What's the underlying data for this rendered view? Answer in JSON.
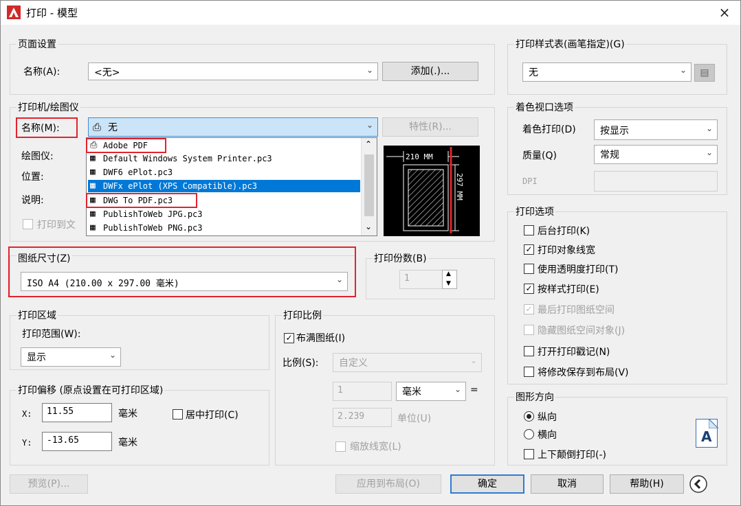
{
  "window": {
    "title": "打印 - 模型",
    "app_icon": "autocad-logo-icon",
    "close": "×"
  },
  "page_setup": {
    "group_label": "页面设置",
    "name_label": "名称(A):",
    "name_value": "<无>",
    "add_button": "添加(.)..."
  },
  "printer": {
    "group_label": "打印机/绘图仪",
    "name_label": "名称(M):",
    "name_value": "无",
    "properties_button": "特性(R)...",
    "plotter_label": "绘图仪:",
    "location_label": "位置:",
    "description_label": "说明:",
    "print_to_file_label": "打印到文",
    "dropdown_items": [
      "Adobe PDF",
      "Default Windows System Printer.pc3",
      "DWF6 ePlot.pc3",
      "DWFx ePlot (XPS Compatible).pc3",
      "DWG To PDF.pc3",
      "PublishToWeb JPG.pc3",
      "PublishToWeb PNG.pc3"
    ],
    "highlighted_index": 3,
    "preview_width": "210 MM",
    "preview_height": "297 MM"
  },
  "paper_size": {
    "group_label": "图纸尺寸(Z)",
    "value": "ISO A4 (210.00 x 297.00 毫米)"
  },
  "copies": {
    "group_label": "打印份数(B)",
    "value": "1"
  },
  "plot_area": {
    "group_label": "打印区域",
    "range_label": "打印范围(W):",
    "range_value": "显示"
  },
  "plot_scale": {
    "group_label": "打印比例",
    "fit_label": "布满图纸(I)",
    "fit_checked": true,
    "scale_label": "比例(S):",
    "scale_value": "自定义",
    "value1": "1",
    "unit1": "毫米",
    "equals": "=",
    "value2": "2.239",
    "unit2": "单位(U)",
    "scale_lineweights": "缩放线宽(L)"
  },
  "plot_offset": {
    "group_label": "打印偏移 (原点设置在可打印区域)",
    "x_label": "X:",
    "x_value": "11.55",
    "x_unit": "毫米",
    "y_label": "Y:",
    "y_value": "-13.65",
    "y_unit": "毫米",
    "center_label": "居中打印(C)"
  },
  "plot_style_table": {
    "group_label": "打印样式表(画笔指定)(G)",
    "value": "无"
  },
  "shaded_viewport": {
    "group_label": "着色视口选项",
    "shade_label": "着色打印(D)",
    "shade_value": "按显示",
    "quality_label": "质量(Q)",
    "quality_value": "常规",
    "dpi_label": "DPI"
  },
  "plot_options": {
    "group_label": "打印选项",
    "items": [
      {
        "label": "后台打印(K)",
        "checked": "",
        "disabled": false
      },
      {
        "label": "打印对象线宽",
        "checked": "✓",
        "disabled": false
      },
      {
        "label": "使用透明度打印(T)",
        "checked": "",
        "disabled": false
      },
      {
        "label": "按样式打印(E)",
        "checked": "✓",
        "disabled": false
      },
      {
        "label": "最后打印图纸空间",
        "checked": "✓",
        "disabled": true
      },
      {
        "label": "隐藏图纸空间对象(J)",
        "checked": "",
        "disabled": true
      },
      {
        "label": "打开打印戳记(N)",
        "checked": "",
        "disabled": false
      },
      {
        "label": "将修改保存到布局(V)",
        "checked": "",
        "disabled": false
      }
    ]
  },
  "orientation": {
    "group_label": "图形方向",
    "portrait": "纵向",
    "landscape": "横向",
    "upside_down": "上下颠倒打印(-)",
    "icon_letter": "A"
  },
  "footer": {
    "preview": "预览(P)...",
    "apply": "应用到布局(O)",
    "ok": "确定",
    "cancel": "取消",
    "help": "帮助(H)",
    "collapse_icon": "chevron-left-circle-icon"
  }
}
